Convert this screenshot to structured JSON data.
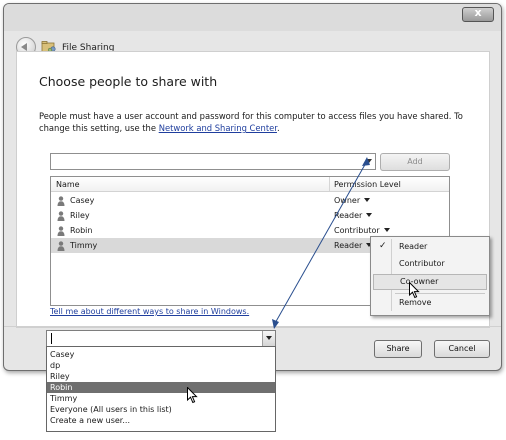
{
  "window": {
    "title": "File Sharing",
    "close_label": "x"
  },
  "main": {
    "heading": "Choose people to share with",
    "info_text": "People must have a user account and password for this computer to access files you have shared.  To change this setting, use the ",
    "info_link": "Network and Sharing Center",
    "info_end": ".",
    "add_button": "Add",
    "share_link": "Tell me about different ways to share in Windows."
  },
  "list": {
    "columns": [
      "Name",
      "Permission Level"
    ],
    "rows": [
      {
        "name": "Casey",
        "permission": "Owner"
      },
      {
        "name": "Riley",
        "permission": "Reader"
      },
      {
        "name": "Robin",
        "permission": "Contributor"
      },
      {
        "name": "Timmy",
        "permission": "Reader"
      }
    ]
  },
  "perm_menu": {
    "items": [
      "Reader",
      "Contributor",
      "Co-owner",
      "Remove"
    ],
    "checked": "Reader",
    "hovered": "Co-owner"
  },
  "user_dropdown": {
    "value": "",
    "options": [
      "Casey",
      "dp",
      "Riley",
      "Robin",
      "Timmy",
      "Everyone (All users in this list)",
      "Create a new user..."
    ],
    "highlighted": "Robin"
  },
  "footer": {
    "share_button": "Share",
    "cancel_button": "Cancel"
  },
  "colors": {
    "link": "#1f3e9e",
    "highlight": "#6f6f6f",
    "annotation_arrow": "#2a4f8f"
  }
}
